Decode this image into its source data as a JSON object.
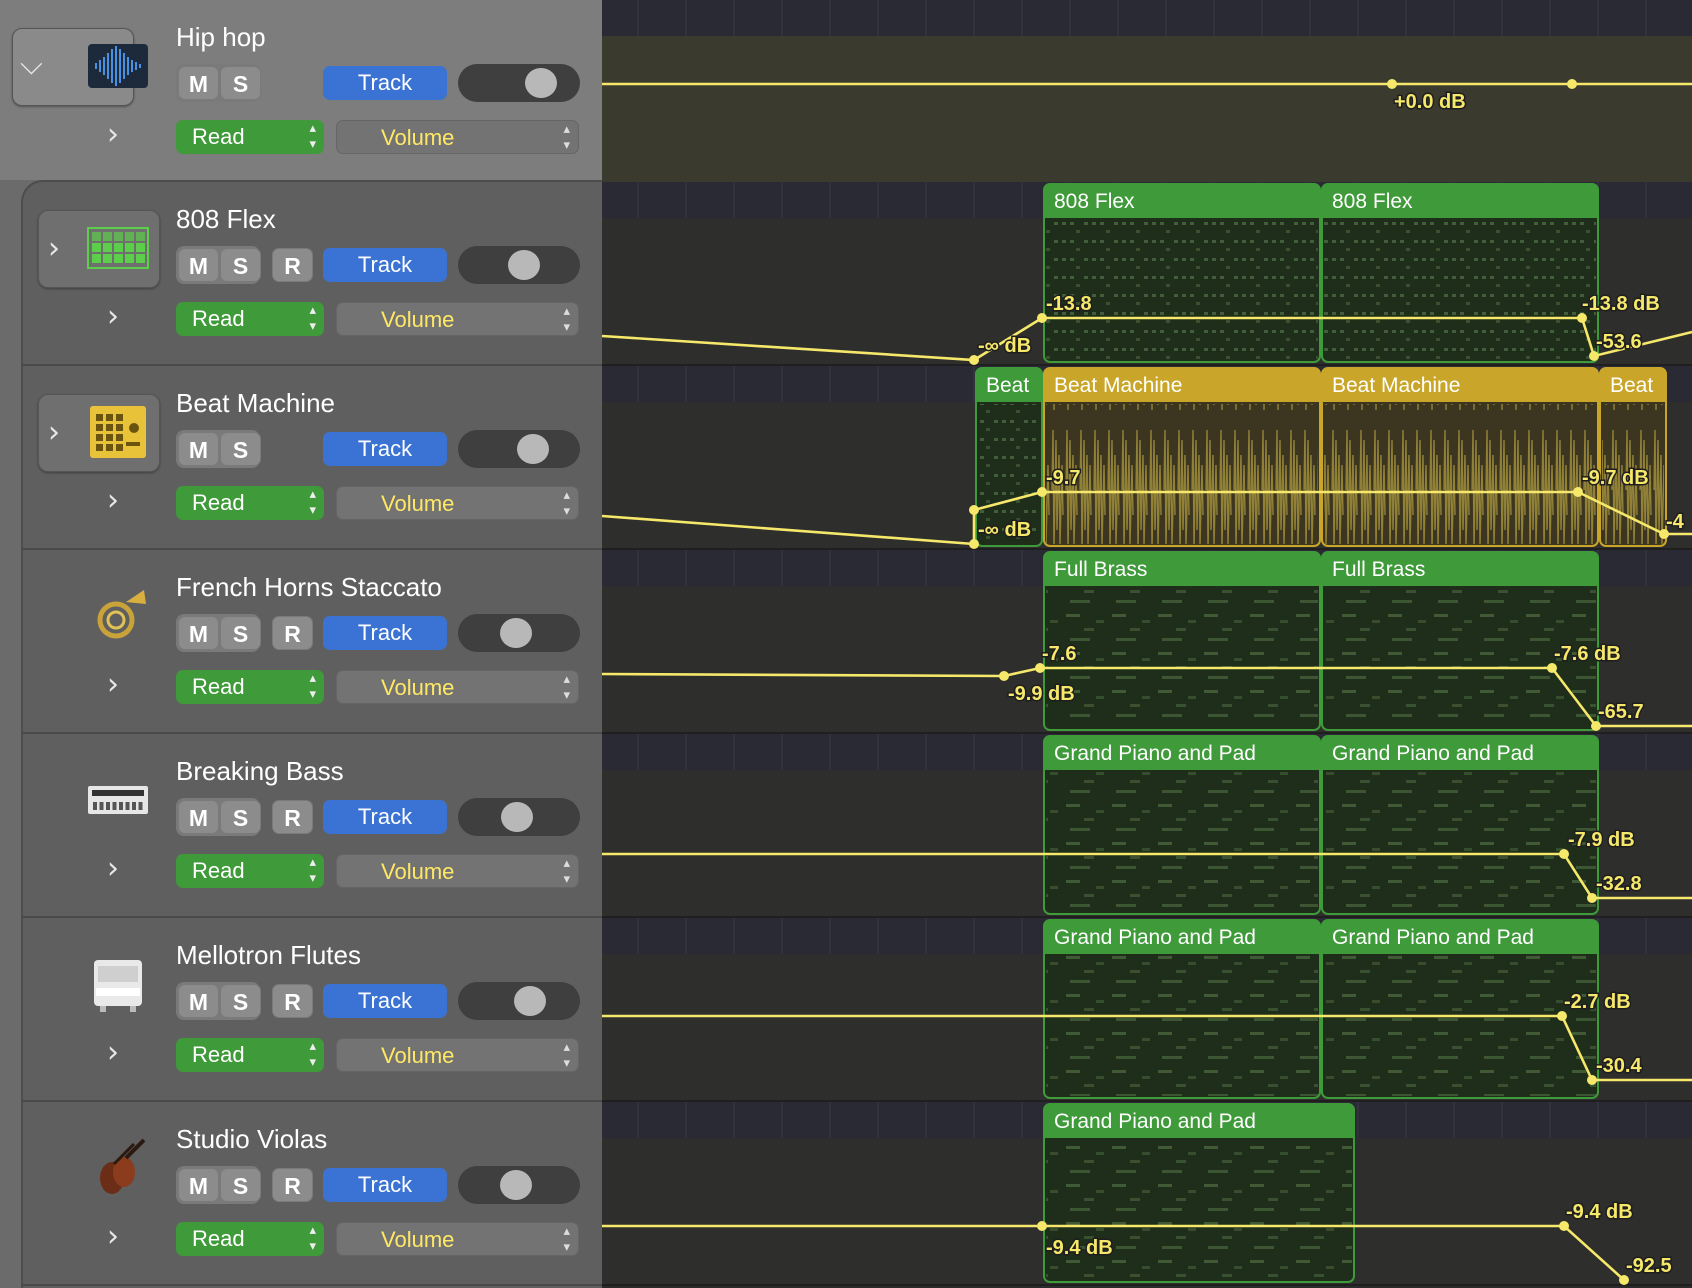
{
  "colors": {
    "region_green": "#3f9a3a",
    "region_yellow": "#c9a62a",
    "automation_line": "#f5e86a",
    "track_button": "#3a73d3"
  },
  "tracks": [
    {
      "name": "Hip hop",
      "icon": "waveform-folder-icon",
      "expander": "chevron-down",
      "buttons": [
        "M",
        "S"
      ],
      "track_label": "Track",
      "knob": 0.75,
      "mode": "Read",
      "param": "Volume",
      "folder": true
    },
    {
      "name": "808 Flex",
      "icon": "drum-machine-grid-icon",
      "expander": "chevron-right",
      "buttons": [
        "M",
        "S",
        "R"
      ],
      "track_label": "Track",
      "knob": 0.55,
      "mode": "Read",
      "param": "Volume"
    },
    {
      "name": "Beat Machine",
      "icon": "beat-machine-icon",
      "expander": "chevron-right",
      "buttons": [
        "M",
        "S"
      ],
      "track_label": "Track",
      "knob": 0.65,
      "mode": "Read",
      "param": "Volume"
    },
    {
      "name": "French Horns Staccato",
      "icon": "french-horn-icon",
      "buttons": [
        "M",
        "S",
        "R"
      ],
      "track_label": "Track",
      "knob": 0.45,
      "mode": "Read",
      "param": "Volume"
    },
    {
      "name": "Breaking Bass",
      "icon": "synth-module-icon",
      "buttons": [
        "M",
        "S",
        "R"
      ],
      "track_label": "Track",
      "knob": 0.47,
      "mode": "Read",
      "param": "Volume"
    },
    {
      "name": "Mellotron Flutes",
      "icon": "mellotron-icon",
      "buttons": [
        "M",
        "S",
        "R"
      ],
      "track_label": "Track",
      "knob": 0.62,
      "mode": "Read",
      "param": "Volume"
    },
    {
      "name": "Studio Violas",
      "icon": "viola-icon",
      "buttons": [
        "M",
        "S",
        "R"
      ],
      "track_label": "Track",
      "knob": 0.45,
      "mode": "Read",
      "param": "Volume"
    }
  ],
  "regions": [
    {
      "track": 1,
      "name": "808 Flex",
      "color": "green"
    },
    {
      "track": 1,
      "name": "808 Flex",
      "color": "green"
    },
    {
      "track": 2,
      "name": "Beat",
      "color": "green"
    },
    {
      "track": 2,
      "name": "Beat Machine",
      "color": "yellow"
    },
    {
      "track": 2,
      "name": "Beat Machine",
      "color": "yellow"
    },
    {
      "track": 2,
      "name": "Beat",
      "color": "yellow"
    },
    {
      "track": 3,
      "name": "Full Brass",
      "color": "green"
    },
    {
      "track": 3,
      "name": "Full Brass",
      "color": "green"
    },
    {
      "track": 4,
      "name": "Grand Piano and Pad",
      "color": "green"
    },
    {
      "track": 4,
      "name": "Grand Piano and Pad",
      "color": "green"
    },
    {
      "track": 5,
      "name": "Grand Piano and Pad",
      "color": "green"
    },
    {
      "track": 5,
      "name": "Grand Piano and Pad",
      "color": "green"
    },
    {
      "track": 6,
      "name": "Grand Piano and Pad",
      "color": "green"
    }
  ],
  "automation_labels": [
    {
      "track": 0,
      "text": "+0.0 dB"
    },
    {
      "track": 1,
      "text": "-∞ dB"
    },
    {
      "track": 1,
      "text": "-13.8"
    },
    {
      "track": 1,
      "text": "-13.8 dB"
    },
    {
      "track": 1,
      "text": "-53.6"
    },
    {
      "track": 2,
      "text": "-∞ dB"
    },
    {
      "track": 2,
      "text": "-9.7"
    },
    {
      "track": 2,
      "text": "-9.7 dB"
    },
    {
      "track": 2,
      "text": "-4"
    },
    {
      "track": 3,
      "text": "-9.9 dB"
    },
    {
      "track": 3,
      "text": "-7.6"
    },
    {
      "track": 3,
      "text": "-7.6 dB"
    },
    {
      "track": 3,
      "text": "-65.7"
    },
    {
      "track": 4,
      "text": "-7.9 dB"
    },
    {
      "track": 4,
      "text": "-32.8"
    },
    {
      "track": 5,
      "text": "-2.7 dB"
    },
    {
      "track": 5,
      "text": "-30.4"
    },
    {
      "track": 6,
      "text": "-9.4 dB"
    },
    {
      "track": 6,
      "text": "-9.4 dB"
    },
    {
      "track": 6,
      "text": "-92.5"
    }
  ]
}
